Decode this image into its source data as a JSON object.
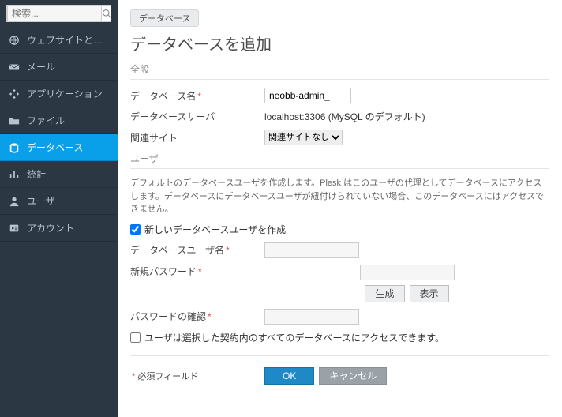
{
  "search": {
    "placeholder": "検索..."
  },
  "sidebar": {
    "items": [
      {
        "label": "ウェブサイトとドメイン"
      },
      {
        "label": "メール"
      },
      {
        "label": "アプリケーション"
      },
      {
        "label": "ファイル"
      },
      {
        "label": "データベース"
      },
      {
        "label": "統計"
      },
      {
        "label": "ユーザ"
      },
      {
        "label": "アカウント"
      }
    ]
  },
  "breadcrumb": {
    "database": "データベース"
  },
  "title": "データベースを追加",
  "sections": {
    "general": "全般",
    "user": "ユーザ"
  },
  "general": {
    "db_name_label": "データベース名",
    "db_name_value": "neobb-admin_",
    "db_server_label": "データベースサーバ",
    "db_server_value": "localhost:3306 (MySQL のデフォルト)",
    "related_site_label": "関連サイト",
    "related_site_value": "関連サイトなし"
  },
  "user": {
    "help": "デフォルトのデータベースユーザを作成します。Plesk はこのユーザの代理としてデータベースにアクセスします。データベースにデータベースユーザが紐付けられていない場合、このデータベースにはアクセスできません。",
    "create_checkbox": "新しいデータベースユーザを作成",
    "username_label": "データベースユーザ名",
    "password_label": "新規パスワード",
    "generate_btn": "生成",
    "show_btn": "表示",
    "confirm_label": "パスワードの確認",
    "access_checkbox": "ユーザは選択した契約内のすべてのデータベースにアクセスできます。"
  },
  "required_legend": "必須フィールド",
  "actions": {
    "ok": "OK",
    "cancel": "キャンセル"
  }
}
